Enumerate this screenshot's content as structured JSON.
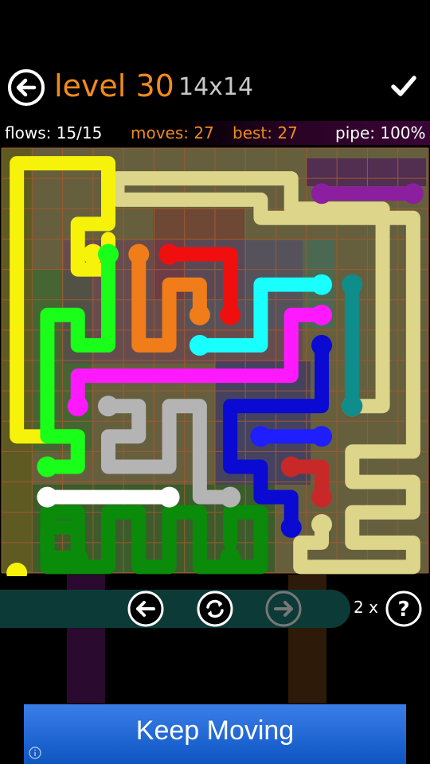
{
  "header": {
    "level_title": "level 30",
    "grid_size": "14x14"
  },
  "stats": {
    "flows": "flows: 15/15",
    "moves": "moves: 27",
    "best": "best: 27",
    "pipe": "pipe: 100%"
  },
  "bottom": {
    "hint_count": "2 x"
  },
  "ad": {
    "text": "Keep Moving"
  },
  "icons": [
    "back-arrow-icon",
    "checkmark-icon",
    "previous-level-icon",
    "restart-icon",
    "next-level-icon",
    "hint-icon",
    "info-icon"
  ],
  "colors": {
    "title": "#f28a1e",
    "moves": "#f28a1e",
    "board_bg": "#6b6442",
    "grid_line": "#9c5a30",
    "button_pill": "#0c3a36"
  },
  "board": {
    "size": 14,
    "flows": [
      {
        "name": "yellow",
        "color": "#f7f20a",
        "path": [
          [
            2,
            9
          ],
          [
            0,
            9
          ],
          [
            0,
            0
          ],
          [
            3,
            0
          ],
          [
            3,
            2
          ],
          [
            2,
            2
          ],
          [
            2,
            3
          ],
          [
            2,
            3.5
          ],
          [
            3,
            3.5
          ],
          [
            3,
            3
          ],
          [
            3,
            2.5
          ]
        ],
        "dots": [
          [
            0,
            13.5
          ],
          [
            2.5,
            3
          ]
        ]
      },
      {
        "name": "beige",
        "color": "#dcd58a",
        "path": []
      },
      {
        "name": "purple",
        "color": "#8c1ea0",
        "path": [
          [
            10,
            1
          ],
          [
            13,
            1
          ]
        ],
        "dots": [
          [
            10,
            1
          ],
          [
            13,
            1
          ]
        ]
      },
      {
        "name": "red",
        "color": "#f00f0f",
        "path": [
          [
            5,
            3
          ],
          [
            7,
            3
          ],
          [
            7,
            5
          ]
        ],
        "dots": [
          [
            5,
            3
          ],
          [
            7,
            5
          ]
        ]
      },
      {
        "name": "orange",
        "color": "#f07d19",
        "path": [
          [
            4,
            3
          ],
          [
            4,
            6
          ],
          [
            5,
            6
          ],
          [
            5,
            4
          ],
          [
            6,
            4
          ],
          [
            6,
            5
          ]
        ],
        "dots": [
          [
            4,
            3
          ],
          [
            6,
            5
          ]
        ]
      },
      {
        "name": "cyan",
        "color": "#19ffff",
        "path": [
          [
            10,
            4
          ],
          [
            8,
            4
          ],
          [
            8,
            6
          ],
          [
            6,
            6
          ]
        ],
        "dots": [
          [
            10,
            4
          ],
          [
            6,
            6
          ]
        ]
      },
      {
        "name": "teal",
        "color": "#0f8c8c",
        "path": [
          [
            11,
            4
          ],
          [
            11,
            8
          ]
        ],
        "dots": [
          [
            11,
            4
          ],
          [
            11,
            8
          ]
        ]
      },
      {
        "name": "green",
        "color": "#19ff19",
        "path": [
          [
            3,
            3
          ],
          [
            3,
            6
          ],
          [
            2,
            6
          ],
          [
            2,
            5
          ],
          [
            1,
            5
          ],
          [
            1,
            9
          ],
          [
            2,
            9
          ],
          [
            2,
            10
          ],
          [
            1,
            10
          ]
        ],
        "dots": [
          [
            3,
            3
          ],
          [
            1,
            10
          ]
        ]
      },
      {
        "name": "magenta",
        "color": "#ff19ff",
        "path": [
          [
            10,
            5
          ],
          [
            9,
            5
          ],
          [
            9,
            7
          ],
          [
            2,
            7
          ],
          [
            2,
            8
          ]
        ],
        "dots": [
          [
            10,
            5
          ],
          [
            2,
            8
          ]
        ]
      },
      {
        "name": "gray",
        "color": "#b4b4b4",
        "path": [
          [
            3,
            8
          ],
          [
            4,
            8
          ],
          [
            4,
            9
          ],
          [
            3,
            9
          ],
          [
            3,
            10
          ],
          [
            5,
            10
          ],
          [
            5,
            8
          ],
          [
            6,
            8
          ],
          [
            6,
            11
          ],
          [
            7,
            11
          ]
        ],
        "dots": [
          [
            3,
            8
          ],
          [
            7,
            11
          ]
        ]
      },
      {
        "name": "blue",
        "color": "#0a0ad2",
        "path": [
          [
            10,
            6
          ],
          [
            10,
            8
          ],
          [
            7,
            8
          ],
          [
            7,
            10
          ],
          [
            8,
            10
          ],
          [
            8,
            11
          ],
          [
            9,
            11
          ],
          [
            9,
            12
          ]
        ],
        "dots": [
          [
            10,
            6
          ],
          [
            9,
            12
          ]
        ]
      },
      {
        "name": "blue2",
        "color": "#1e1eff",
        "path": [
          [
            8,
            9
          ],
          [
            10,
            9
          ]
        ],
        "dots": [
          [
            8,
            9
          ],
          [
            10,
            9
          ]
        ]
      },
      {
        "name": "darkred",
        "color": "#c82828",
        "path": [
          [
            9,
            10
          ],
          [
            10,
            10
          ],
          [
            10,
            11
          ]
        ],
        "dots": [
          [
            9,
            10
          ],
          [
            10,
            11
          ]
        ]
      },
      {
        "name": "white",
        "color": "#ffffff",
        "path": [
          [
            1,
            11
          ],
          [
            5,
            11
          ]
        ],
        "dots": [
          [
            1,
            11
          ],
          [
            5,
            11
          ]
        ]
      },
      {
        "name": "darkgreen",
        "color": "#0a8c0a",
        "path": [
          [
            2,
            13
          ],
          [
            1,
            13
          ],
          [
            1,
            12
          ],
          [
            2,
            12
          ],
          [
            2,
            13
          ]
        ],
        "dots": [
          [
            2,
            13
          ],
          [
            7,
            13
          ]
        ]
      }
    ]
  }
}
